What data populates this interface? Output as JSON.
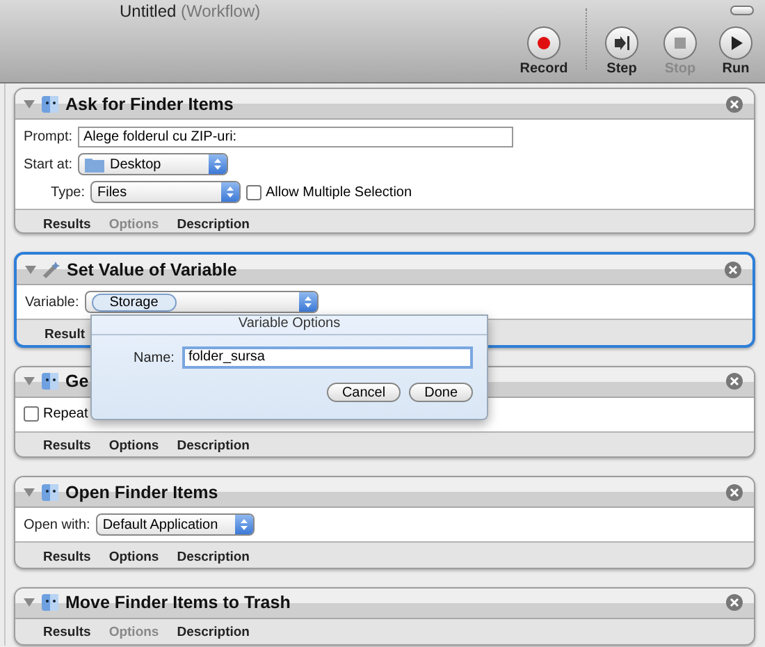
{
  "window": {
    "title": "Untitled",
    "subtitle": "(Workflow)"
  },
  "toolbar": [
    {
      "kind": "record",
      "label": "Record",
      "disabled": false
    },
    {
      "kind": "step",
      "label": "Step",
      "disabled": false
    },
    {
      "kind": "stop",
      "label": "Stop",
      "disabled": true
    },
    {
      "kind": "run",
      "label": "Run",
      "disabled": false
    }
  ],
  "actions": [
    {
      "title": "Ask for Finder Items",
      "selected": false,
      "rows": [
        {
          "items": [
            {
              "kind": "label",
              "text": "Prompt:"
            },
            {
              "kind": "text_field",
              "value": "Alege folderul cu ZIP-uri:"
            }
          ]
        },
        {
          "items": [
            {
              "kind": "label",
              "text": "Start at:"
            },
            {
              "kind": "folder_popup",
              "value": "Desktop"
            }
          ]
        },
        {
          "items": [
            {
              "kind": "label",
              "text": "Type:"
            },
            {
              "kind": "popup",
              "value": "Files"
            },
            {
              "kind": "checkbox",
              "text": "Allow Multiple Selection",
              "checked": false
            }
          ]
        }
      ],
      "footer": [
        {
          "label": "Results",
          "disabled": false
        },
        {
          "label": "Options",
          "disabled": true
        },
        {
          "label": "Description",
          "disabled": false
        }
      ]
    },
    {
      "title": "Set Value of Variable",
      "selected": true,
      "rows": [
        {
          "items": [
            {
              "kind": "label",
              "text": "Variable:"
            },
            {
              "kind": "variable_popup",
              "value": "Storage"
            }
          ]
        }
      ],
      "footer": [
        {
          "label": "Result",
          "disabled": false
        }
      ]
    },
    {
      "title": "Ge",
      "selected": false,
      "rows": [
        {
          "items": [
            {
              "kind": "checkbox",
              "text": "Repeat",
              "checked": false
            }
          ]
        }
      ],
      "footer": [
        {
          "label": "Results",
          "disabled": false
        },
        {
          "label": "Options",
          "disabled": false
        },
        {
          "label": "Description",
          "disabled": false
        }
      ]
    },
    {
      "title": "Open Finder Items",
      "selected": false,
      "rows": [
        {
          "items": [
            {
              "kind": "label",
              "text": "Open with:"
            },
            {
              "kind": "popup",
              "value": "Default Application"
            }
          ]
        }
      ],
      "footer": [
        {
          "label": "Results",
          "disabled": false
        },
        {
          "label": "Options",
          "disabled": false
        },
        {
          "label": "Description",
          "disabled": false
        }
      ]
    },
    {
      "title": "Move Finder Items to Trash",
      "selected": false,
      "footer": [
        {
          "label": "Results",
          "disabled": false
        },
        {
          "label": "Options",
          "disabled": true
        },
        {
          "label": "Description",
          "disabled": false
        }
      ]
    }
  ],
  "dialog": {
    "title": "Variable Options",
    "label": "Name:",
    "value": "folder_sursa",
    "buttons": [
      "Cancel",
      "Done"
    ]
  }
}
